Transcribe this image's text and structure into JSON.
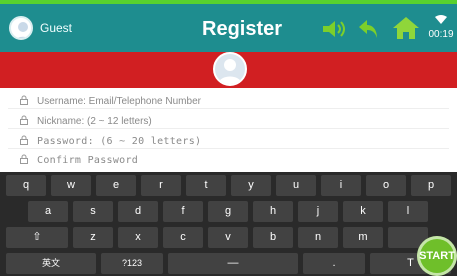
{
  "header": {
    "user_label": "Guest",
    "title": "Register",
    "time": "00:19"
  },
  "form": {
    "username_placeholder": "Username: Email/Telephone Number",
    "nickname_placeholder": "Nickname: (2 ~ 12 letters)",
    "password_placeholder": "Password: (6 ~ 20 letters)",
    "confirm_placeholder": "Confirm Password"
  },
  "keyboard": {
    "row1": [
      "q",
      "w",
      "e",
      "r",
      "t",
      "y",
      "u",
      "i",
      "o",
      "p"
    ],
    "row2": [
      "a",
      "s",
      "d",
      "f",
      "g",
      "h",
      "j",
      "k",
      "l"
    ],
    "shift_label": "⇧",
    "row3": [
      "z",
      "x",
      "c",
      "v",
      "b",
      "n",
      "m"
    ],
    "lang_label": "英文",
    "numbers_label": "?123",
    "space_label": "—",
    "period_label": ".",
    "search_label": "T"
  },
  "start_label": "START",
  "colors": {
    "header": "#1e8d8f",
    "band": "#d11f22",
    "accent": "#58d12e",
    "home": "#8fd63a",
    "keyboard": "#2a2a2a"
  },
  "icons": {
    "sound": "speaker-icon",
    "back": "undo-arrow-icon",
    "home": "home-icon",
    "wifi": "wifi-icon",
    "lock": "lock-icon",
    "avatar": "user-avatar-icon"
  }
}
